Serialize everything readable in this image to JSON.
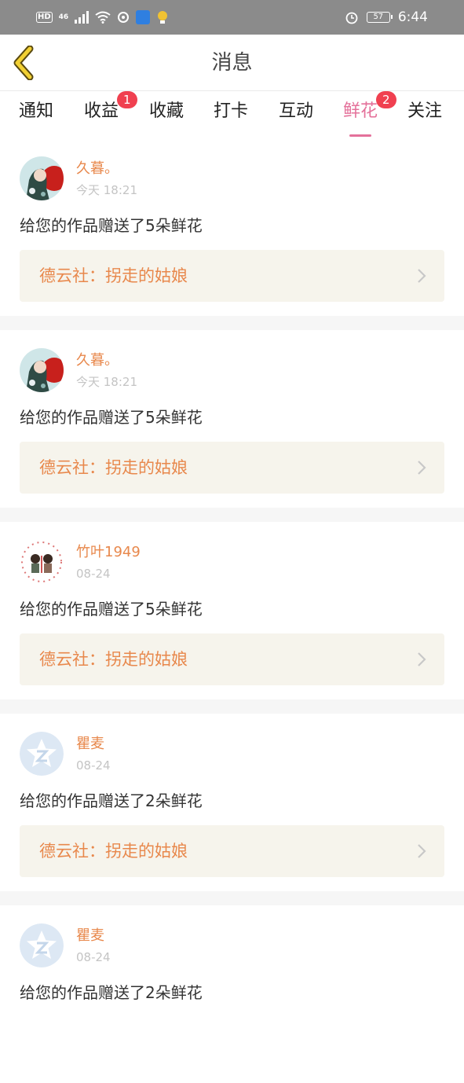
{
  "status_bar": {
    "network_badge": "HD",
    "network_type": "46",
    "battery": "57",
    "time": "6:44",
    "icons": [
      "hd-icon",
      "signal-icon",
      "wifi-icon",
      "sync-icon",
      "app-notification-icon",
      "bulb-icon",
      "alarm-icon",
      "battery-icon"
    ]
  },
  "header": {
    "title": "消息",
    "back_icon": "chevron-left-icon"
  },
  "tabs": [
    {
      "label": "通知",
      "badge": ""
    },
    {
      "label": "收益",
      "badge": "1"
    },
    {
      "label": "收藏",
      "badge": ""
    },
    {
      "label": "打卡",
      "badge": ""
    },
    {
      "label": "互动",
      "badge": ""
    },
    {
      "label": "鲜花",
      "badge": "2",
      "active": true
    },
    {
      "label": "关注",
      "badge": ""
    }
  ],
  "messages": [
    {
      "user": "久暮。",
      "time": "今天 18:21",
      "text": "给您的作品赠送了5朵鲜花",
      "work": "德云社：拐走的姑娘",
      "avatar": "photo-avatar"
    },
    {
      "user": "久暮。",
      "time": "今天 18:21",
      "text": "给您的作品赠送了5朵鲜花",
      "work": "德云社：拐走的姑娘",
      "avatar": "photo-avatar"
    },
    {
      "user": "竹叶1949",
      "time": "08-24",
      "text": "给您的作品赠送了5朵鲜花",
      "work": "德云社：拐走的姑娘",
      "avatar": "cartoon-avatar"
    },
    {
      "user": "瞿麦",
      "time": "08-24",
      "text": "给您的作品赠送了2朵鲜花",
      "work": "德云社：拐走的姑娘",
      "avatar": "default-avatar"
    },
    {
      "user": "瞿麦",
      "time": "08-24",
      "text": "给您的作品赠送了2朵鲜花",
      "work": "",
      "avatar": "default-avatar"
    }
  ],
  "colors": {
    "accent_pink": "#e4719a",
    "orange_text": "#e8884c",
    "badge_red": "#f04050",
    "card_link_bg": "#f6f4ec",
    "status_bar_bg": "#8b8b8b"
  }
}
